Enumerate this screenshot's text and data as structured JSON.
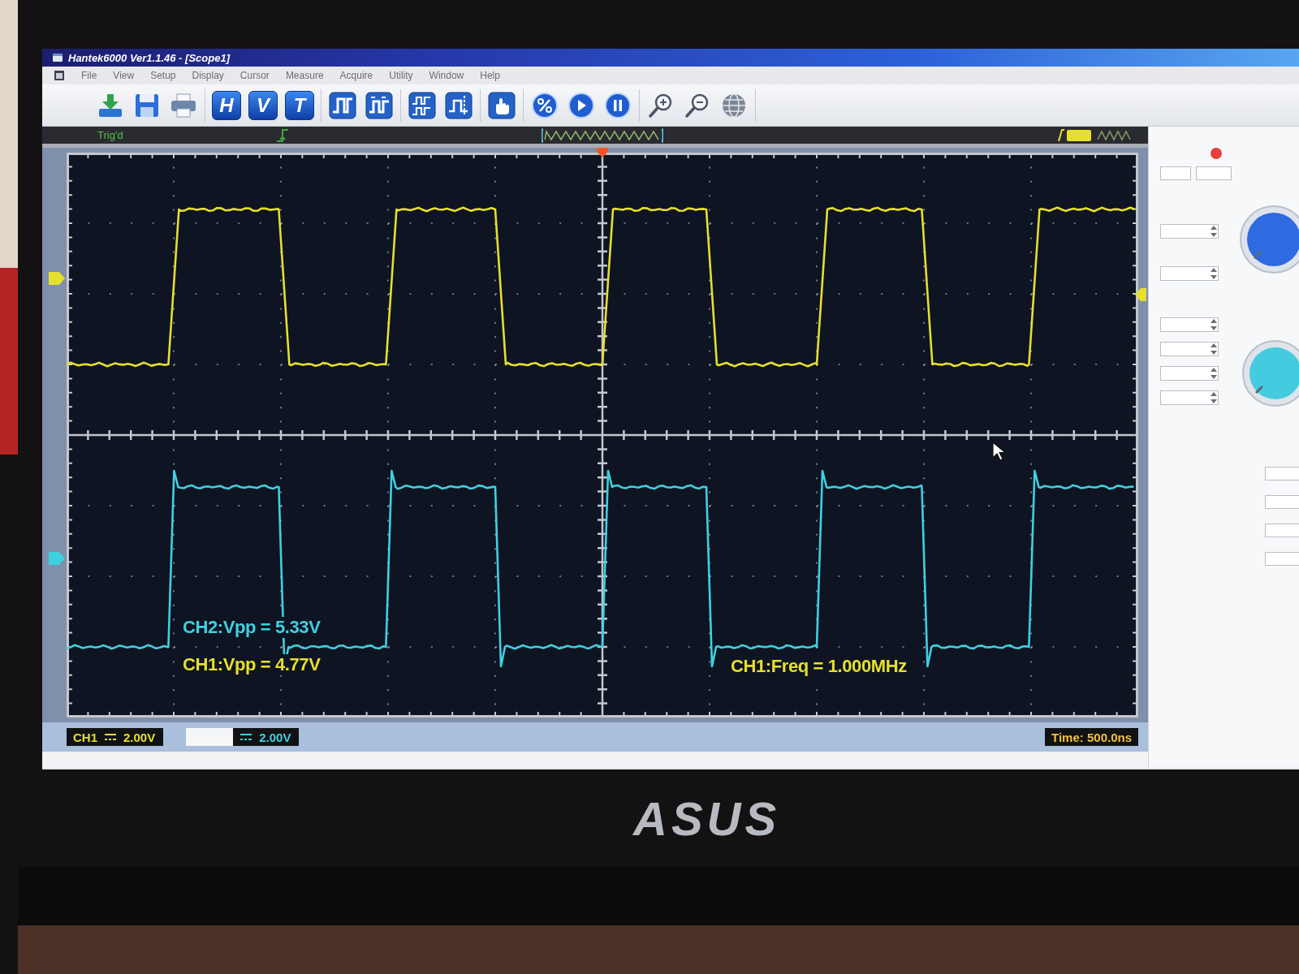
{
  "window": {
    "title": "Hantek6000 Ver1.1.46 - [Scope1]"
  },
  "menu": [
    "File",
    "View",
    "Setup",
    "Display",
    "Cursor",
    "Measure",
    "Acquire",
    "Utility",
    "Window",
    "Help"
  ],
  "toolbar": [
    [
      {
        "kind": "download"
      },
      {
        "kind": "save"
      },
      {
        "kind": "print"
      }
    ],
    [
      {
        "kind": "letter",
        "label": "H"
      },
      {
        "kind": "letter",
        "label": "V"
      },
      {
        "kind": "letter",
        "label": "T"
      }
    ],
    [
      {
        "kind": "pulse"
      },
      {
        "kind": "pulse-marks"
      }
    ],
    [
      {
        "kind": "multi-pulse"
      },
      {
        "kind": "cursor"
      }
    ],
    [
      {
        "kind": "hand"
      }
    ],
    [
      {
        "kind": "percent"
      },
      {
        "kind": "play"
      },
      {
        "kind": "pause"
      }
    ],
    [
      {
        "kind": "zoom-in"
      },
      {
        "kind": "zoom-out"
      },
      {
        "kind": "globe"
      }
    ]
  ],
  "status_strip": {
    "trigger_state": "Trig'd"
  },
  "scope": {
    "channels": [
      {
        "name": "CH1",
        "color": "#e6df2e",
        "highlighted": false,
        "scale": "2.00V"
      },
      {
        "color": "#3fd0e0",
        "highlighted": true,
        "scale": "2.00V"
      }
    ],
    "measurements": [
      {
        "text": "CH2:Vpp = 5.33V",
        "color": "#3fd0e0"
      },
      {
        "text": "CH1:Vpp = 4.77V",
        "color": "#e6df2e"
      },
      {
        "text": "CH1:Freq = 1.000MHz",
        "color": "#e6df2e"
      }
    ],
    "timebase": "Time: 500.0ns"
  },
  "laptop": {
    "logo": "ASUS"
  }
}
